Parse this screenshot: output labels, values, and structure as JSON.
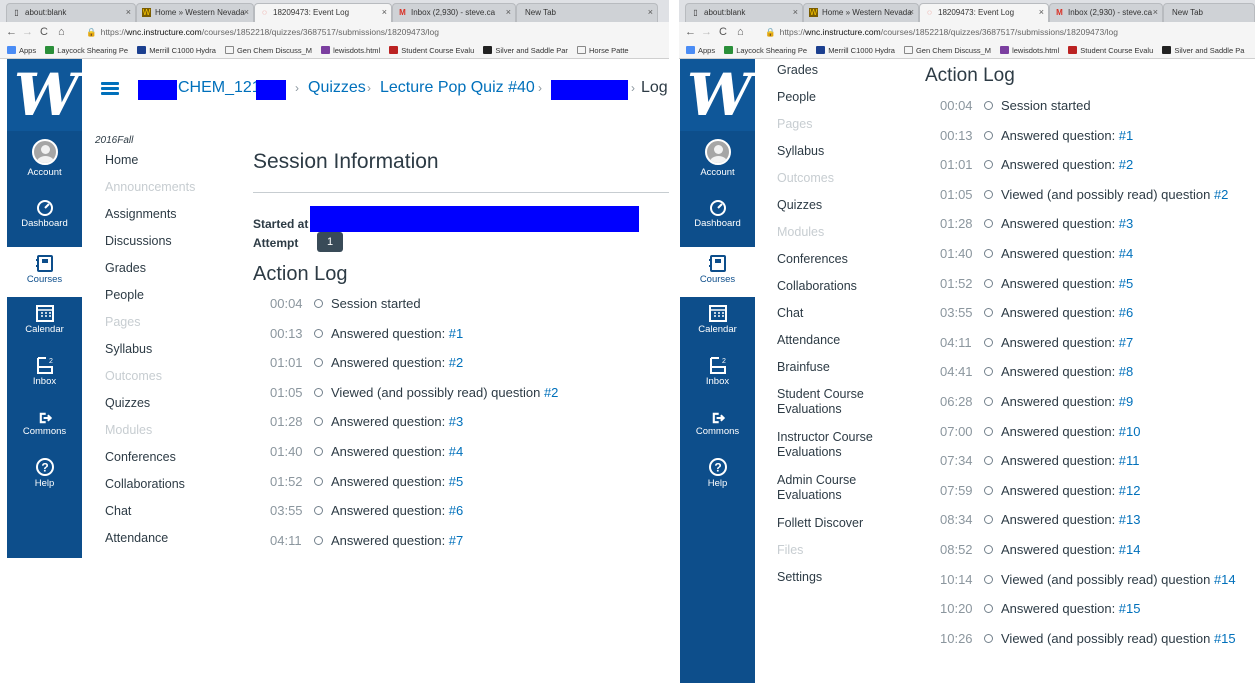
{
  "left": {
    "tabs": [
      {
        "title": "about:blank"
      },
      {
        "title": "Home » Western Nevada"
      },
      {
        "title": "18209473: Event Log"
      },
      {
        "title": "Inbox (2,930) - steve.ca"
      },
      {
        "title": "New Tab"
      }
    ],
    "url": {
      "scheme": "https://",
      "host": "wnc.instructure.com",
      "path": "/courses/1852218/quizzes/3687517/submissions/18209473/log"
    },
    "bookmarks": [
      "Apps",
      "Laycock Shearing Pe",
      "Merrill C1000 Hydra",
      "Gen Chem Discuss_M",
      "lewisdots.html",
      "Student Course Evalu",
      "Silver and Saddle Par",
      "Horse Patte"
    ],
    "breadcrumbs": {
      "course": "CHEM_121_",
      "quizzes": "Quizzes",
      "quiz": "Lecture Pop Quiz #40",
      "current": "Log"
    },
    "term": "2016Fall",
    "course_nav": [
      {
        "label": "Home",
        "disabled": false
      },
      {
        "label": "Announcements",
        "disabled": true
      },
      {
        "label": "Assignments",
        "disabled": false
      },
      {
        "label": "Discussions",
        "disabled": false
      },
      {
        "label": "Grades",
        "disabled": false
      },
      {
        "label": "People",
        "disabled": false
      },
      {
        "label": "Pages",
        "disabled": true
      },
      {
        "label": "Syllabus",
        "disabled": false
      },
      {
        "label": "Outcomes",
        "disabled": true
      },
      {
        "label": "Quizzes",
        "disabled": false
      },
      {
        "label": "Modules",
        "disabled": true
      },
      {
        "label": "Conferences",
        "disabled": false
      },
      {
        "label": "Collaborations",
        "disabled": false
      },
      {
        "label": "Chat",
        "disabled": false
      },
      {
        "label": "Attendance",
        "disabled": false
      }
    ],
    "session_title": "Session Information",
    "started_label": "Started at",
    "attempt_label": "Attempt",
    "attempt_value": "1",
    "action_log_title": "Action Log",
    "log": [
      {
        "time": "00:04",
        "text": "Session started",
        "q": ""
      },
      {
        "time": "00:13",
        "text": "Answered question: ",
        "q": "#1"
      },
      {
        "time": "01:01",
        "text": "Answered question: ",
        "q": "#2"
      },
      {
        "time": "01:05",
        "text": "Viewed (and possibly read) question ",
        "q": "#2"
      },
      {
        "time": "01:28",
        "text": "Answered question: ",
        "q": "#3"
      },
      {
        "time": "01:40",
        "text": "Answered question: ",
        "q": "#4"
      },
      {
        "time": "01:52",
        "text": "Answered question: ",
        "q": "#5"
      },
      {
        "time": "03:55",
        "text": "Answered question: ",
        "q": "#6"
      },
      {
        "time": "04:11",
        "text": "Answered question: ",
        "q": "#7"
      }
    ]
  },
  "right": {
    "tabs": [
      {
        "title": "about:blank"
      },
      {
        "title": "Home » Western Nevada"
      },
      {
        "title": "18209473: Event Log"
      },
      {
        "title": "Inbox (2,930) - steve.ca"
      },
      {
        "title": "New Tab"
      }
    ],
    "url": {
      "scheme": "https://",
      "host": "wnc.instructure.com",
      "path": "/courses/1852218/quizzes/3687517/submissions/18209473/log"
    },
    "bookmarks": [
      "Apps",
      "Laycock Shearing Pe",
      "Merrill C1000 Hydra",
      "Gen Chem Discuss_M",
      "lewisdots.html",
      "Student Course Evalu",
      "Silver and Saddle Pa"
    ],
    "course_nav": [
      {
        "label": "Grades",
        "disabled": false
      },
      {
        "label": "People",
        "disabled": false
      },
      {
        "label": "Pages",
        "disabled": true
      },
      {
        "label": "Syllabus",
        "disabled": false
      },
      {
        "label": "Outcomes",
        "disabled": true
      },
      {
        "label": "Quizzes",
        "disabled": false
      },
      {
        "label": "Modules",
        "disabled": true
      },
      {
        "label": "Conferences",
        "disabled": false
      },
      {
        "label": "Collaborations",
        "disabled": false
      },
      {
        "label": "Chat",
        "disabled": false
      },
      {
        "label": "Attendance",
        "disabled": false
      },
      {
        "label": "Brainfuse",
        "disabled": false
      },
      {
        "label": "Student Course",
        "label2": "Evaluations",
        "disabled": false
      },
      {
        "label": "Instructor Course",
        "label2": "Evaluations",
        "disabled": false
      },
      {
        "label": "Admin Course",
        "label2": "Evaluations",
        "disabled": false
      },
      {
        "label": "Follett Discover",
        "disabled": false
      },
      {
        "label": "Files",
        "disabled": true
      },
      {
        "label": "Settings",
        "disabled": false
      }
    ],
    "action_log_title": "Action Log",
    "log": [
      {
        "time": "00:04",
        "text": "Session started",
        "q": ""
      },
      {
        "time": "00:13",
        "text": "Answered question: ",
        "q": "#1"
      },
      {
        "time": "01:01",
        "text": "Answered question: ",
        "q": "#2"
      },
      {
        "time": "01:05",
        "text": "Viewed (and possibly read) question ",
        "q": "#2"
      },
      {
        "time": "01:28",
        "text": "Answered question: ",
        "q": "#3"
      },
      {
        "time": "01:40",
        "text": "Answered question: ",
        "q": "#4"
      },
      {
        "time": "01:52",
        "text": "Answered question: ",
        "q": "#5"
      },
      {
        "time": "03:55",
        "text": "Answered question: ",
        "q": "#6"
      },
      {
        "time": "04:11",
        "text": "Answered question: ",
        "q": "#7"
      },
      {
        "time": "04:41",
        "text": "Answered question: ",
        "q": "#8"
      },
      {
        "time": "06:28",
        "text": "Answered question: ",
        "q": "#9"
      },
      {
        "time": "07:00",
        "text": "Answered question: ",
        "q": "#10"
      },
      {
        "time": "07:34",
        "text": "Answered question: ",
        "q": "#11"
      },
      {
        "time": "07:59",
        "text": "Answered question: ",
        "q": "#12"
      },
      {
        "time": "08:34",
        "text": "Answered question: ",
        "q": "#13"
      },
      {
        "time": "08:52",
        "text": "Answered question: ",
        "q": "#14"
      },
      {
        "time": "10:14",
        "text": "Viewed (and possibly read) question ",
        "q": "#14"
      },
      {
        "time": "10:20",
        "text": "Answered question: ",
        "q": "#15"
      },
      {
        "time": "10:26",
        "text": "Viewed (and possibly read) question ",
        "q": "#15"
      }
    ]
  },
  "global_nav": [
    {
      "label": "Account",
      "icon": "account-icon"
    },
    {
      "label": "Dashboard",
      "icon": "dashboard-icon"
    },
    {
      "label": "Courses",
      "icon": "courses-icon"
    },
    {
      "label": "Calendar",
      "icon": "calendar-icon"
    },
    {
      "label": "Inbox",
      "icon": "inbox-icon",
      "badge": "2"
    },
    {
      "label": "Commons",
      "icon": "commons-icon"
    },
    {
      "label": "Help",
      "icon": "help-icon"
    }
  ],
  "logo_text": "W",
  "colors": {
    "nav_bg": "#0d4e8b",
    "link": "#0070bb",
    "redaction": "#0000ff"
  }
}
